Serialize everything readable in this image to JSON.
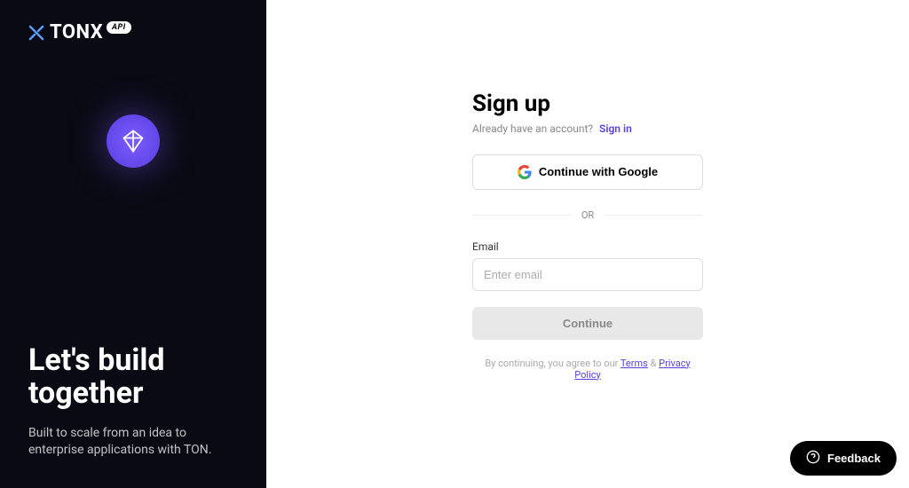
{
  "sidebar": {
    "brand_name": "TONX",
    "api_badge": "API",
    "headline": "Let's build together",
    "subhead": "Built to scale from an idea to enterprise applications with TON."
  },
  "form": {
    "title": "Sign up",
    "have_account_text": "Already have an account?",
    "signin_link": "Sign in",
    "google_button": "Continue with Google",
    "divider_text": "OR",
    "email_label": "Email",
    "email_placeholder": "Enter email",
    "continue_button": "Continue",
    "legal_prefix": "By continuing, you agree to our ",
    "terms_link": "Terms",
    "legal_and": " & ",
    "privacy_link": "Privacy Policy"
  },
  "feedback": {
    "label": "Feedback"
  }
}
